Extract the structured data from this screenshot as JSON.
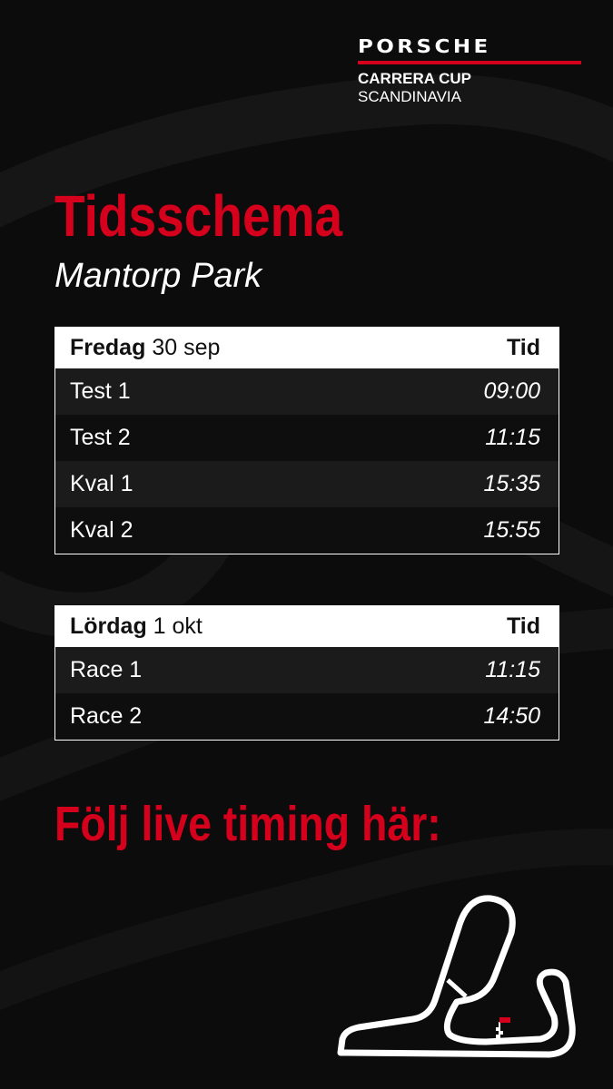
{
  "brand": {
    "wordmark": "PORSCHE",
    "series": "CARRERA CUP",
    "region": "SCANDINAVIA",
    "accent_color": "#d5001c"
  },
  "title": "Tidsschema",
  "subtitle": "Mantorp Park",
  "friday": {
    "day": "Fredag",
    "date": "30 sep",
    "time_header": "Tid",
    "sessions": [
      {
        "name": "Test 1",
        "time": "09:00"
      },
      {
        "name": "Test 2",
        "time": "11:15"
      },
      {
        "name": "Kval 1",
        "time": "15:35"
      },
      {
        "name": "Kval 2",
        "time": "15:55"
      }
    ]
  },
  "saturday": {
    "day": "Lördag",
    "date": "1 okt",
    "time_header": "Tid",
    "sessions": [
      {
        "name": "Race 1",
        "time": "11:15"
      },
      {
        "name": "Race 2",
        "time": "14:50"
      }
    ]
  },
  "cta": "Följ live timing här:",
  "icons": {
    "track": "track-map-icon",
    "flag": "checkered-flag-icon"
  }
}
